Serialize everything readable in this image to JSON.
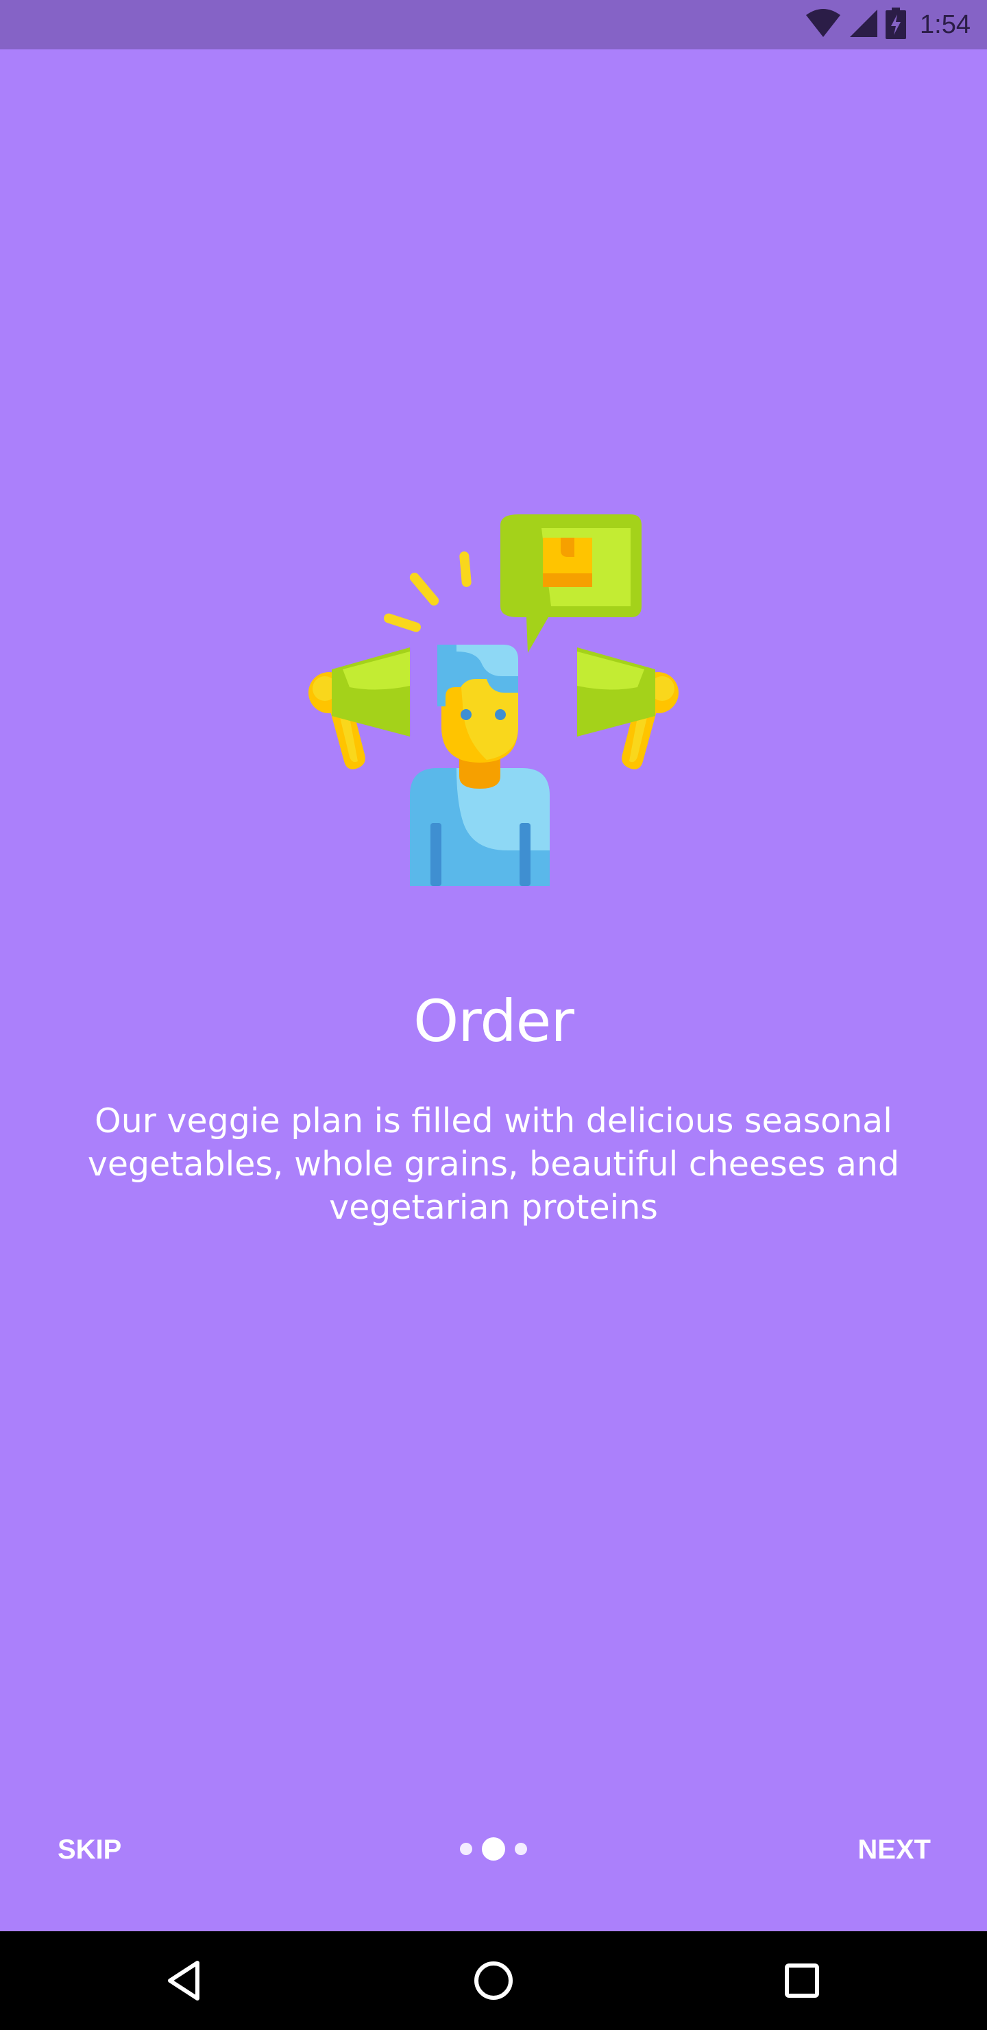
{
  "status_bar": {
    "time": "1:54",
    "icons": [
      "wifi-icon",
      "signal-icon",
      "battery-charging-icon"
    ]
  },
  "onboarding": {
    "illustration": "person-with-megaphones-icon",
    "title": "Order",
    "description": "Our veggie plan is filled with delicious seasonal vegetables, whole grains, beautiful cheeses and vegetarian proteins"
  },
  "controls": {
    "skip_label": "SKIP",
    "next_label": "NEXT",
    "page_count": 3,
    "active_page": 2
  },
  "nav_bar": {
    "buttons": [
      "back-icon",
      "home-icon",
      "recents-icon"
    ]
  },
  "colors": {
    "background": "#ab80fb",
    "status_bar": "#8563c6",
    "text": "#ffffff",
    "nav_bar": "#000000"
  }
}
